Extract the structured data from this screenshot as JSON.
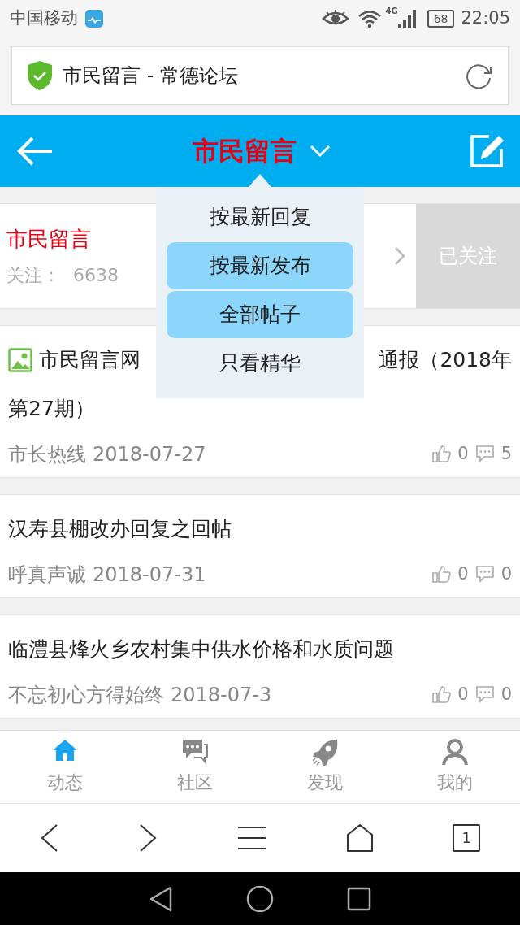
{
  "status_bar": {
    "carrier": "中国移动",
    "network": "4G",
    "battery": "68",
    "time": "22:05"
  },
  "address_bar": {
    "title": "市民留言 - 常德论坛"
  },
  "header": {
    "title": "市民留言"
  },
  "dropdown": [
    {
      "label": "按最新回复",
      "selected": false
    },
    {
      "label": "按最新发布",
      "selected": true
    },
    {
      "label": "全部帖子",
      "selected": true
    },
    {
      "label": "只看精华",
      "selected": false
    }
  ],
  "forum": {
    "name": "市民留言",
    "followers_label": "关注：",
    "followers": "6638",
    "follow_button": "已关注"
  },
  "posts": [
    {
      "has_image": true,
      "title_start": "市民留言网",
      "title_end": "通报（2018年",
      "title_line2": "第27期）",
      "author": "市长热线",
      "date": "2018-07-27",
      "likes": "0",
      "comments": "5"
    },
    {
      "has_image": false,
      "title_start": "汉寿县棚改办回复之回帖",
      "author": "呼真声诚",
      "date": "2018-07-31",
      "likes": "0",
      "comments": "0"
    },
    {
      "has_image": false,
      "title_start": "临澧县烽火乡农村集中供水价格和水质问题",
      "author": "不忘初心方得始终",
      "date": "2018-07-3",
      "likes": "0",
      "comments": "0"
    }
  ],
  "tabs": [
    {
      "kind": "home",
      "label": "动态",
      "selected": true
    },
    {
      "kind": "community",
      "label": "社区",
      "selected": false
    },
    {
      "kind": "discover",
      "label": "发现",
      "selected": false
    },
    {
      "kind": "profile",
      "label": "我的",
      "selected": false
    }
  ],
  "browser_toolbar": {
    "tab_count": "1"
  }
}
